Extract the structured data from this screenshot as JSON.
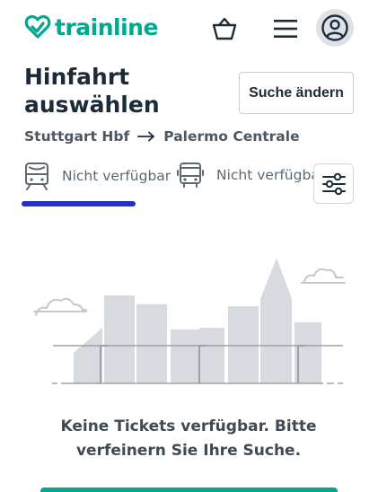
{
  "header": {
    "brand": "trainline",
    "brand_color": "#00a88f",
    "icons": [
      "basket-icon",
      "menu-icon",
      "account-icon"
    ]
  },
  "page": {
    "title": "Hinfahrt auswählen",
    "search_button": "Suche ändern"
  },
  "route": {
    "from": "Stuttgart Hbf",
    "to": "Palermo Centrale"
  },
  "tabs": [
    {
      "mode": "train",
      "icon": "train-icon",
      "label": "Nicht verfügbar",
      "active": true
    },
    {
      "mode": "bus",
      "icon": "bus-icon",
      "label": "Nicht verfügbar",
      "active": false
    }
  ],
  "filter": {
    "icon": "filter-sliders-icon"
  },
  "empty_state": {
    "illustration": "city-skyline-illustration",
    "message": "Keine Tickets verfügbar. Bitte verfeinern Sie Ihre Suche."
  },
  "colors": {
    "accent": "#00a88f",
    "tab_indicator": "#2332c4",
    "text": "#1c2b39"
  }
}
